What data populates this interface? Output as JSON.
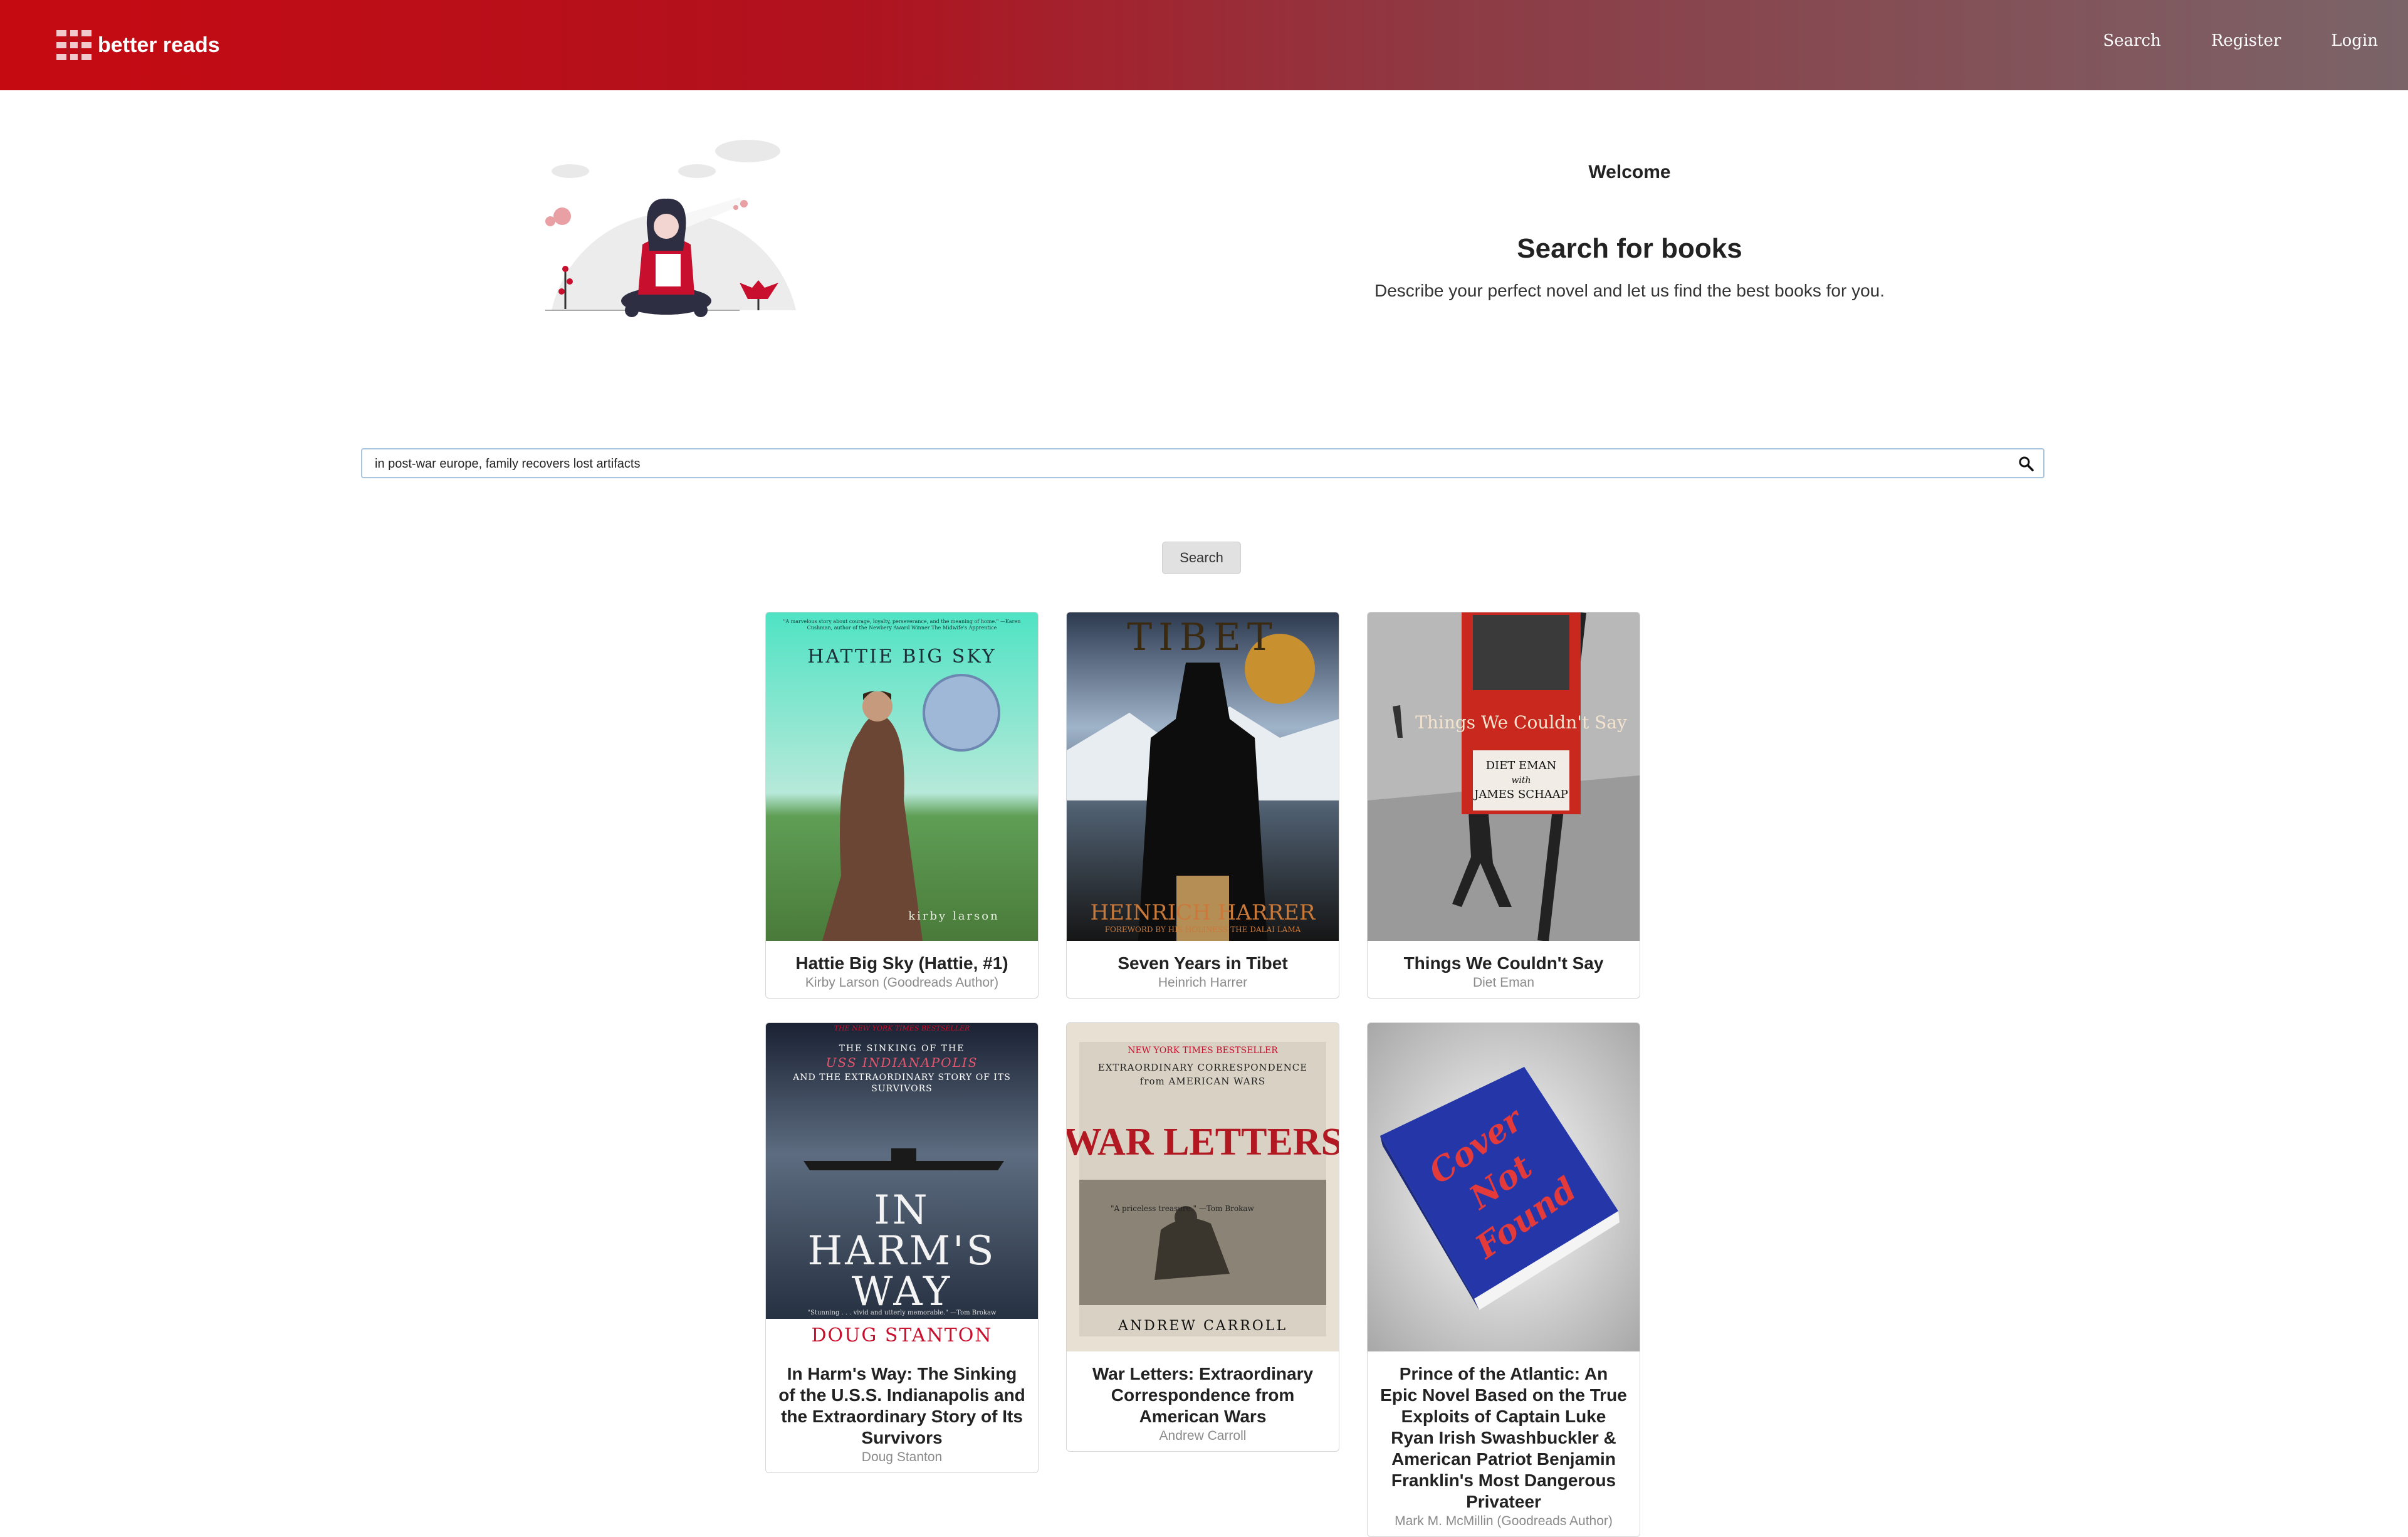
{
  "navbar": {
    "brand": "better reads",
    "links": [
      "Search",
      "Register",
      "Login"
    ]
  },
  "hero": {
    "welcome": "Welcome",
    "title": "Search for books",
    "subtitle": "Describe your perfect novel and let us find the best books for you."
  },
  "search": {
    "value": "in post-war europe, family recovers lost artifacts",
    "button_label": "Search"
  },
  "books": [
    {
      "title": "Hattie Big Sky (Hattie, #1)",
      "author": "Kirby Larson (Goodreads Author)",
      "cover_title": "HATTIE BIG SKY",
      "cover_author": "kirby larson",
      "cover_blurb": "\"A marvelous story about courage, loyalty, perseverance, and the meaning of home.\" —Karen Cushman, author of the Newbery Award Winner The Midwife's Apprentice"
    },
    {
      "title": "Seven Years in Tibet",
      "author": "Heinrich Harrer",
      "cover_title": "TIBET",
      "cover_author": "HEINRICH HARRER",
      "cover_sub": "FOREWORD BY HIS HOLINESS THE DALAI LAMA"
    },
    {
      "title": "Things We Couldn't Say",
      "author": "Diet Eman",
      "cover_title": "Things We Couldn't Say",
      "cover_author": "DIET EMAN",
      "cover_with": "with",
      "cover_coauthor": "JAMES SCHAAP"
    },
    {
      "title": "In Harm's Way: The Sinking of the U.S.S. Indianapolis and the Extraordinary Story of Its Survivors",
      "author": "Doug Stanton",
      "cover_banner": "THE NEW YORK TIMES BESTSELLER",
      "cover_sub1": "THE SINKING OF THE",
      "cover_sub2": "USS INDIANAPOLIS",
      "cover_sub3": "AND THE EXTRAORDINARY STORY OF ITS SURVIVORS",
      "cover_title1": "IN",
      "cover_title2": "HARM'S",
      "cover_title3": "WAY",
      "cover_quote": "\"Stunning . . . vivid and utterly memorable.\" —Tom Brokaw",
      "cover_author": "DOUG STANTON"
    },
    {
      "title": "War Letters: Extraordinary Correspondence from American Wars",
      "author": "Andrew Carroll",
      "cover_banner": "NEW YORK TIMES BESTSELLER",
      "cover_sub": "EXTRAORDINARY CORRESPONDENCE from AMERICAN WARS",
      "cover_title": "WAR LETTERS",
      "cover_quote": "\"A priceless treasure.\" —Tom Brokaw",
      "cover_author": "ANDREW CARROLL"
    },
    {
      "title": "Prince of the Atlantic: An Epic Novel Based on the True Exploits of Captain Luke Ryan Irish Swashbuckler & American Patriot Benjamin Franklin's Most Dangerous Privateer",
      "author": "Mark M. McMillin (Goodreads Author)",
      "cover_text": [
        "Cover",
        "Not",
        "Found"
      ]
    }
  ],
  "colors": {
    "nav_start": "#c60a12",
    "nav_end": "#7a6468",
    "accent_red": "#c8102e"
  }
}
